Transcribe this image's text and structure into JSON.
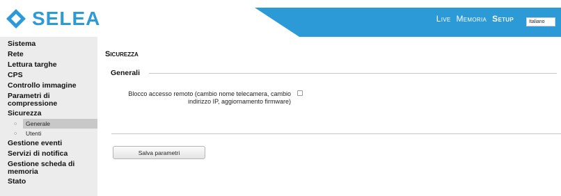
{
  "header": {
    "logo_text": "SELEA",
    "logo_icon": "selea-diamond-logo",
    "brand_color": "#2c9ad6",
    "nav": [
      {
        "label": "Live",
        "active": false
      },
      {
        "label": "Memoria",
        "active": false
      },
      {
        "label": "Setup",
        "active": true
      }
    ],
    "language": {
      "selected": "Italiano"
    }
  },
  "sidebar": {
    "items": [
      {
        "label": "Sistema"
      },
      {
        "label": "Rete"
      },
      {
        "label": "Lettura targhe"
      },
      {
        "label": "CPS"
      },
      {
        "label": "Controllo immagine"
      },
      {
        "label": "Parametri di compressione"
      },
      {
        "label": "Sicurezza"
      },
      {
        "label": "Gestione eventi"
      },
      {
        "label": "Servizi di notifica"
      },
      {
        "label": "Gestione scheda di memoria"
      },
      {
        "label": "Stato"
      }
    ],
    "subitems": [
      {
        "label": "Generale",
        "active": true
      },
      {
        "label": "Utenti",
        "active": false
      }
    ]
  },
  "main": {
    "title": "Sicurezza",
    "section_legend": "Generali",
    "option_label": "Blocco accesso remoto (cambio nome telecamera, cambio indirizzo IP, aggiornamento firmware)",
    "option_checked": false,
    "save_label": "Salva parametri"
  }
}
